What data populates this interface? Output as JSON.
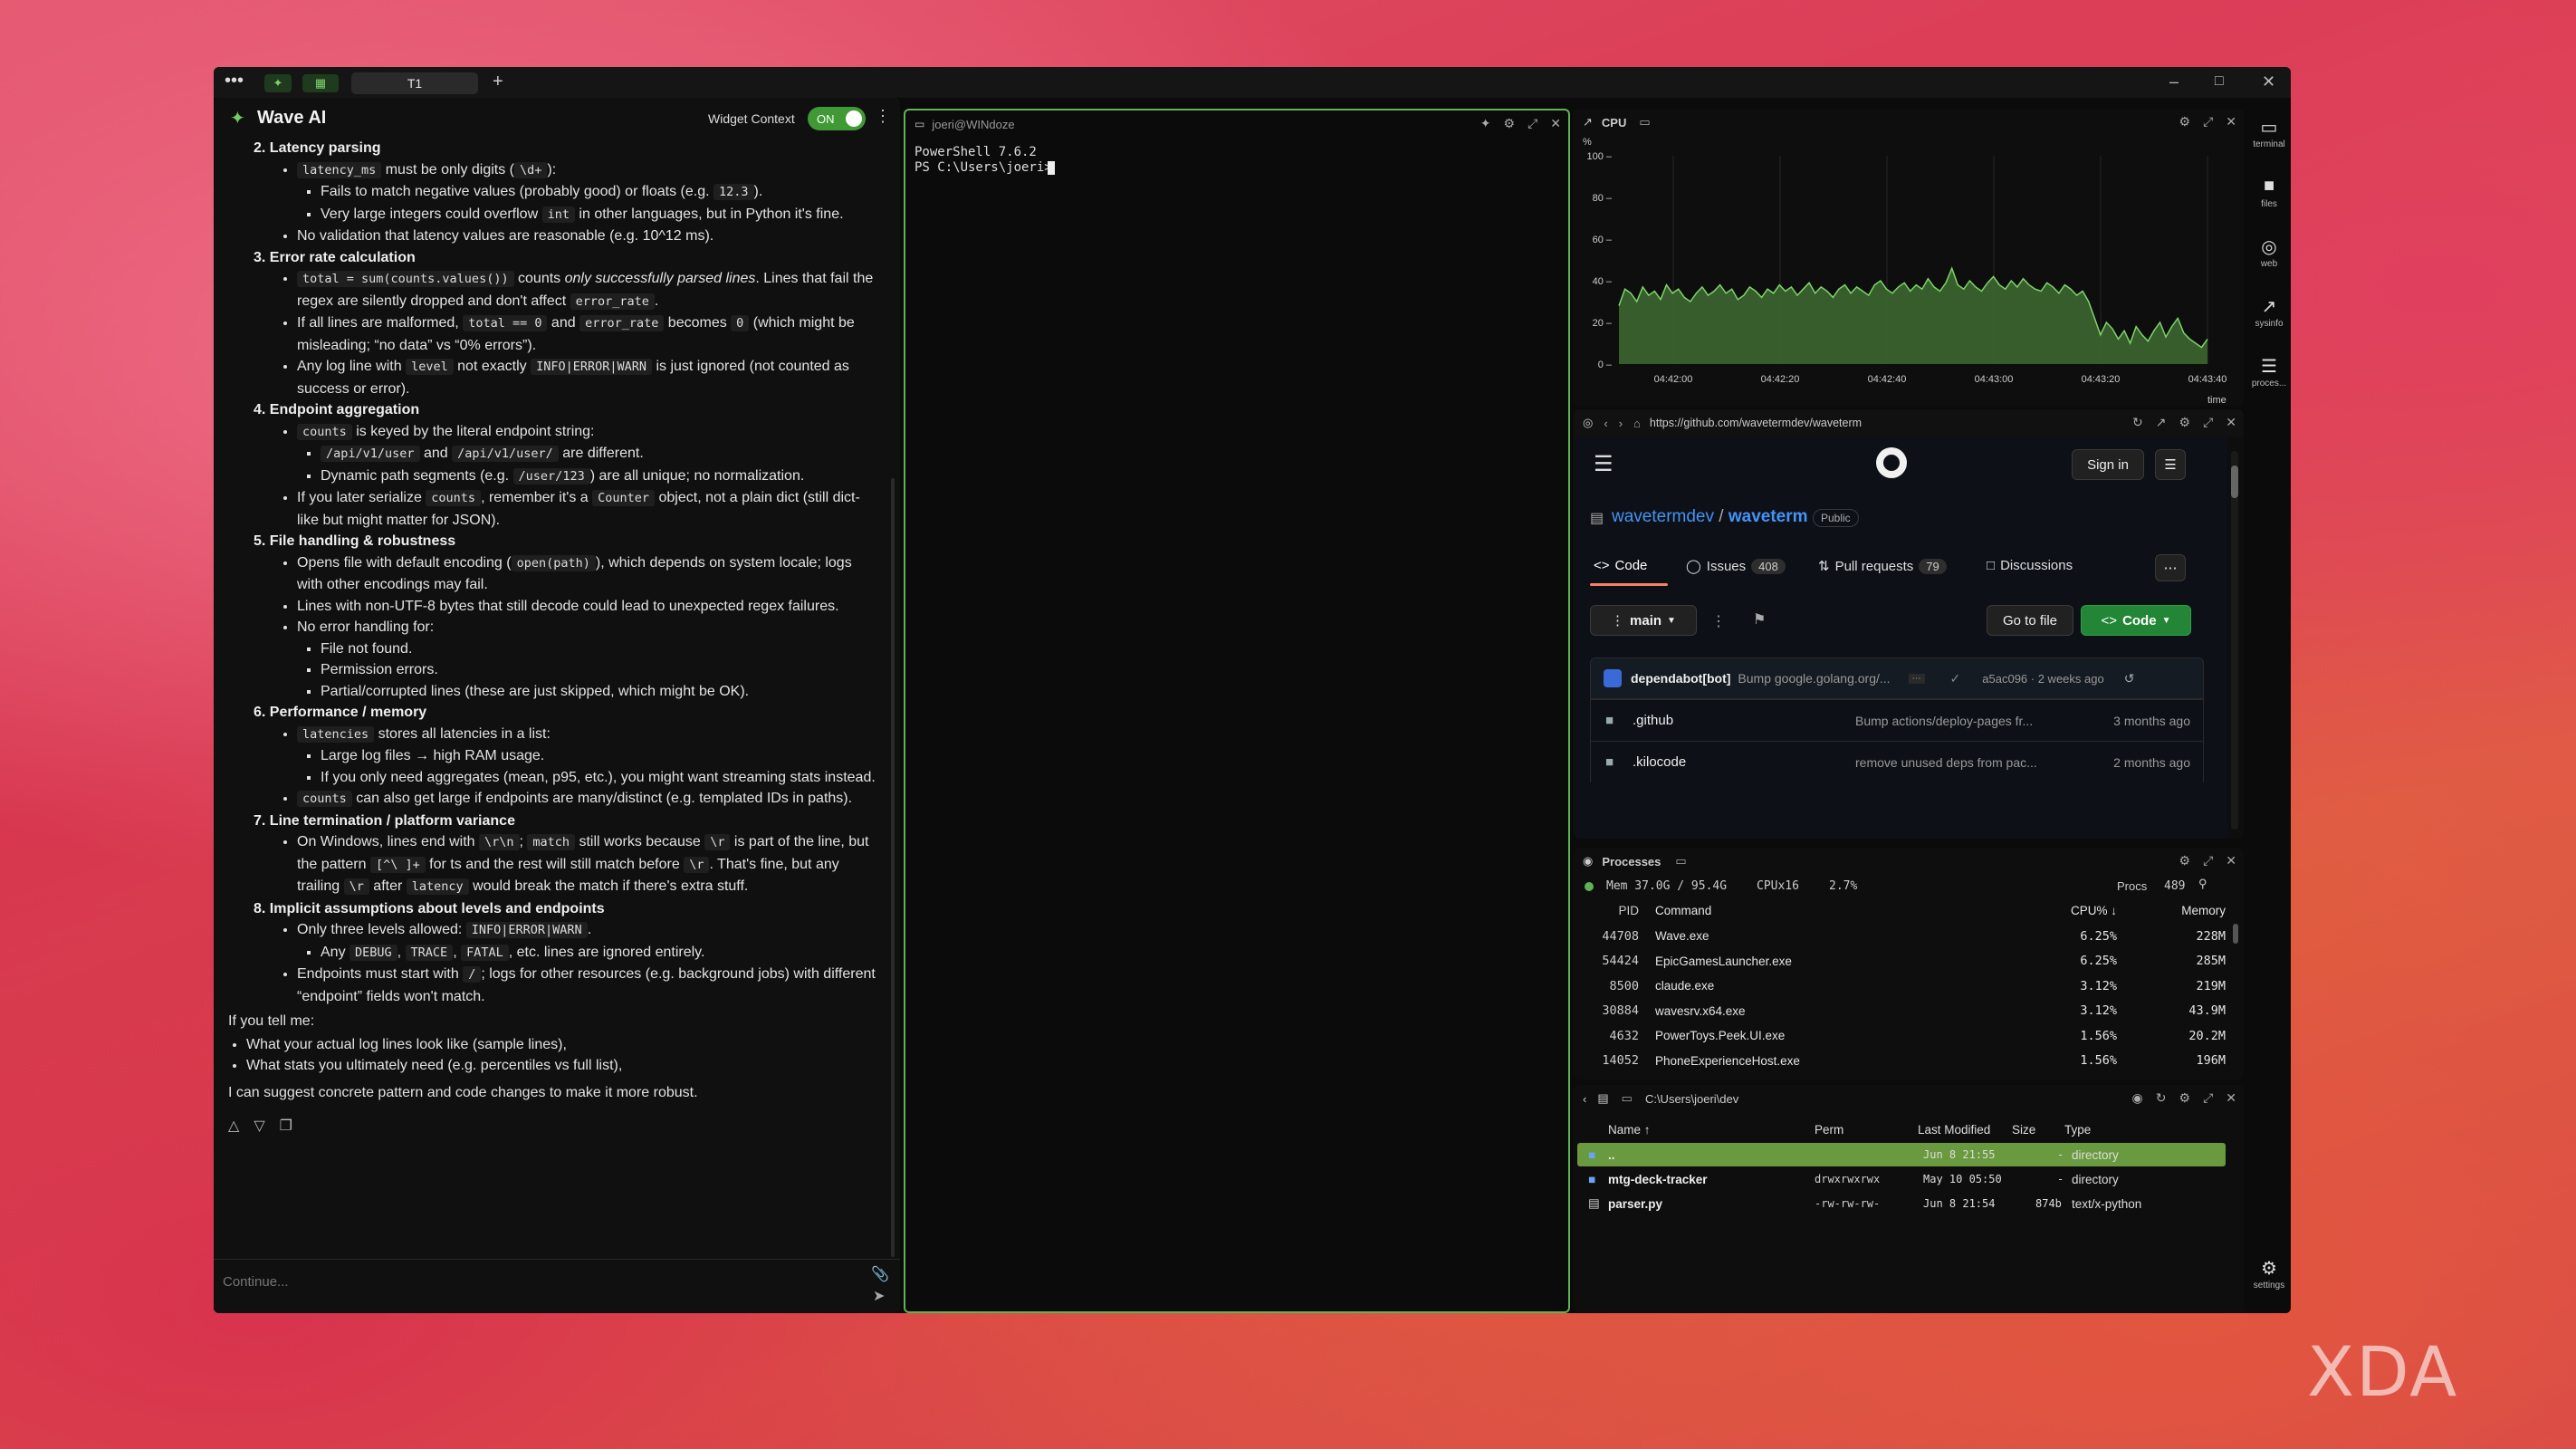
{
  "tabbar": {
    "tab_label": "T1",
    "add": "+"
  },
  "ai": {
    "title": "Wave AI",
    "widget_context_label": "Widget Context",
    "toggle_label": "ON",
    "input_placeholder": "Continue...",
    "sections": [
      {
        "n": "2.",
        "title": "Latency parsing"
      },
      {
        "n": "3.",
        "title": "Error rate calculation"
      },
      {
        "n": "4.",
        "title": "Endpoint aggregation"
      },
      {
        "n": "5.",
        "title": "File handling & robustness"
      },
      {
        "n": "6.",
        "title": "Performance / memory"
      },
      {
        "n": "7.",
        "title": "Line termination / platform variance"
      },
      {
        "n": "8.",
        "title": "Implicit assumptions about levels and endpoints"
      }
    ],
    "t": {
      "s2_a_code": "latency_ms",
      "s2_a_text": " must be only digits (",
      "s2_a_code2": "\\d+",
      "s2_a_end": "):",
      "s2_a1": "Fails to match negative values (probably good) or floats (e.g. ",
      "s2_a1_code": "12.3",
      "s2_a1_end": ").",
      "s2_a2": "Very large integers could overflow ",
      "s2_a2_code": "int",
      "s2_a2_end": " in other languages, but in Python it's fine.",
      "s2_b": "No validation that latency values are reasonable (e.g. 10^12 ms).",
      "s3_a_code": "total = sum(counts.values())",
      "s3_a_text": " counts ",
      "s3_a_em": "only successfully parsed lines",
      "s3_a_end": ". Lines that fail the regex are silently dropped and don't affect ",
      "s3_a_code2": "error_rate",
      "s3_a_end2": ".",
      "s3_b": "If all lines are malformed, ",
      "s3_b_code": "total == 0",
      "s3_b_mid": " and ",
      "s3_b_code2": "error_rate",
      "s3_b_mid2": " becomes ",
      "s3_b_code3": "0",
      "s3_b_end": " (which might be misleading; “no data” vs “0% errors”).",
      "s3_c": "Any log line with ",
      "s3_c_code": "level",
      "s3_c_mid": " not exactly ",
      "s3_c_code2": "INFO|ERROR|WARN",
      "s3_c_end": " is just ignored (not counted as success or error).",
      "s4_a_code": "counts",
      "s4_a_end": " is keyed by the literal endpoint string:",
      "s4_a1_code": "/api/v1/user",
      "s4_a1_mid": " and ",
      "s4_a1_code2": "/api/v1/user/",
      "s4_a1_end": " are different.",
      "s4_a2": "Dynamic path segments (e.g. ",
      "s4_a2_code": "/user/123",
      "s4_a2_end": ") are all unique; no normalization.",
      "s4_b": "If you later serialize ",
      "s4_b_code": "counts",
      "s4_b_mid": ", remember it's a ",
      "s4_b_code2": "Counter",
      "s4_b_end": " object, not a plain dict (still dict-like but might matter for JSON).",
      "s5_a": "Opens file with default encoding (",
      "s5_a_code": "open(path)",
      "s5_a_end": "), which depends on system locale; logs with other encodings may fail.",
      "s5_b": "Lines with non-UTF-8 bytes that still decode could lead to unexpected regex failures.",
      "s5_c": "No error handling for:",
      "s5_c1": "File not found.",
      "s5_c2": "Permission errors.",
      "s5_c3": "Partial/corrupted lines (these are just skipped, which might be OK).",
      "s6_a_code": "latencies",
      "s6_a_end": " stores all latencies in a list:",
      "s6_a1": "Large log files → high RAM usage.",
      "s6_a2": "If you only need aggregates (mean, p95, etc.), you might want streaming stats instead.",
      "s6_b_code": "counts",
      "s6_b_end": " can also get large if endpoints are many/distinct (e.g. templated IDs in paths).",
      "s7_a": "On Windows, lines end with ",
      "s7_a_code": "\\r\\n",
      "s7_a_mid": "; ",
      "s7_a_code2": "match",
      "s7_a_mid2": " still works because ",
      "s7_a_code3": "\\r",
      "s7_a_mid3": " is part of the line, but the pattern ",
      "s7_a_code4": "[^\\ ]+",
      "s7_a_mid4": " for ts and the rest will still match before ",
      "s7_a_code5": "\\r",
      "s7_a_mid5": ". That's fine, but any trailing ",
      "s7_a_code6": "\\r",
      "s7_a_mid6": " after ",
      "s7_a_code7": "latency",
      "s7_a_end": " would break the match if there's extra stuff.",
      "s8_a": "Only three levels allowed: ",
      "s8_a_code": "INFO|ERROR|WARN",
      "s8_a_end": ".",
      "s8_a1": "Any ",
      "s8_a1_c1": "DEBUG",
      "s8_a1_s": ", ",
      "s8_a1_c2": "TRACE",
      "s8_a1_s2": ", ",
      "s8_a1_c3": "FATAL",
      "s8_a1_end": ", etc. lines are ignored entirely.",
      "s8_b": "Endpoints must start with ",
      "s8_b_code": "/",
      "s8_b_end": "; logs for other resources (e.g. background jobs) with different “endpoint” fields won't match.",
      "tell": "If you tell me:",
      "tell1": "What your actual log lines look like (sample lines),",
      "tell2": "What stats you ultimately need (e.g. percentiles vs full list),",
      "closing": "I can suggest concrete pattern and code changes to make it more robust."
    }
  },
  "terminal": {
    "header": "joeri@WINdoze",
    "lines": "PowerShell 7.6.2\nPS C:\\Users\\joeri> "
  },
  "cpu": {
    "title": "CPU",
    "unit": "%",
    "xlabel": "time"
  },
  "chart_data": {
    "type": "area",
    "title": "CPU",
    "ylabel": "%",
    "xlabel": "time",
    "ylim": [
      0,
      100
    ],
    "yticks": [
      0,
      20,
      40,
      60,
      80,
      100
    ],
    "xticks": [
      "04:42:00",
      "04:42:20",
      "04:42:40",
      "04:43:00",
      "04:43:20",
      "04:43:40"
    ],
    "series": [
      {
        "values": [
          28,
          36,
          34,
          30,
          37,
          33,
          35,
          31,
          38,
          34,
          36,
          32,
          30,
          34,
          37,
          33,
          35,
          38,
          34,
          36,
          31,
          33,
          37,
          35,
          32,
          36,
          34,
          38,
          35,
          37,
          33,
          36,
          39,
          34,
          37,
          35,
          32,
          36,
          38,
          34,
          37,
          35,
          33,
          38,
          40,
          36,
          34,
          37,
          39,
          35,
          38,
          36,
          41,
          37,
          35,
          39,
          46,
          38,
          36,
          40,
          37,
          35,
          39,
          42,
          38,
          36,
          40,
          37,
          41,
          38,
          36,
          35,
          39,
          37,
          34,
          38,
          36,
          33,
          35,
          30,
          22,
          14,
          20,
          17,
          12,
          16,
          10,
          18,
          14,
          11,
          16,
          20,
          13,
          18,
          22,
          15,
          12,
          10,
          8,
          12
        ]
      }
    ]
  },
  "web": {
    "url": "https://github.com/wavetermdev/waveterm",
    "sign_in": "Sign in",
    "owner": "wavetermdev",
    "slash": " / ",
    "repo": "waveterm",
    "visibility": "Public",
    "tabs": [
      {
        "label": "Code"
      },
      {
        "label": "Issues",
        "count": "408"
      },
      {
        "label": "Pull requests",
        "count": "79"
      },
      {
        "label": "Discussions"
      }
    ],
    "branch": "main",
    "go_to_file": "Go to file",
    "code_btn": "Code",
    "commit": {
      "author": "dependabot[bot]",
      "message": "Bump google.golang.org/...",
      "hash_time": "a5ac096 · 2 weeks ago"
    },
    "rows": [
      {
        "name": ".github",
        "msg": "Bump actions/deploy-pages fr...",
        "time": "3 months ago"
      },
      {
        "name": ".kilocode",
        "msg": "remove unused deps from pac...",
        "time": "2 months ago"
      }
    ]
  },
  "processes": {
    "title": "Processes",
    "mem": "Mem 37.0G / 95.4G",
    "cpux": "CPUx16",
    "cpu_pct": "2.7%",
    "procs_label": "Procs",
    "procs_count": "489",
    "headers": {
      "pid": "PID",
      "cmd": "Command",
      "cpu": "CPU% ↓",
      "mem": "Memory"
    },
    "rows": [
      {
        "pid": "44708",
        "cmd": "Wave.exe",
        "cpu": "6.25%",
        "mem": "228M"
      },
      {
        "pid": "54424",
        "cmd": "EpicGamesLauncher.exe",
        "cpu": "6.25%",
        "mem": "285M"
      },
      {
        "pid": "8500",
        "cmd": "claude.exe",
        "cpu": "3.12%",
        "mem": "219M"
      },
      {
        "pid": "30884",
        "cmd": "wavesrv.x64.exe",
        "cpu": "3.12%",
        "mem": "43.9M"
      },
      {
        "pid": "4632",
        "cmd": "PowerToys.Peek.UI.exe",
        "cpu": "1.56%",
        "mem": "20.2M"
      },
      {
        "pid": "14052",
        "cmd": "PhoneExperienceHost.exe",
        "cpu": "1.56%",
        "mem": "196M"
      }
    ]
  },
  "files": {
    "path": "C:\\Users\\joeri\\dev",
    "headers": {
      "name": "Name ↑",
      "perm": "Perm",
      "modified": "Last Modified",
      "size": "Size",
      "type": "Type"
    },
    "rows": [
      {
        "name": "..",
        "perm": "",
        "modified": "Jun 8 21:55",
        "size": "-",
        "type": "directory"
      },
      {
        "name": "mtg-deck-tracker",
        "perm": "drwxrwxrwx",
        "modified": "May 10 05:50",
        "size": "-",
        "type": "directory"
      },
      {
        "name": "parser.py",
        "perm": "-rw-rw-rw-",
        "modified": "Jun 8 21:54",
        "size": "874b",
        "type": "text/x-python"
      }
    ]
  },
  "rail": [
    {
      "label": "terminal"
    },
    {
      "label": "files"
    },
    {
      "label": "web"
    },
    {
      "label": "sysinfo"
    },
    {
      "label": "proces..."
    }
  ],
  "rail_settings": "settings",
  "watermark": "XDA",
  "colors": {
    "accent_green": "#5fb355",
    "chart_fill": "#3d6b30",
    "github_green": "#238636"
  }
}
